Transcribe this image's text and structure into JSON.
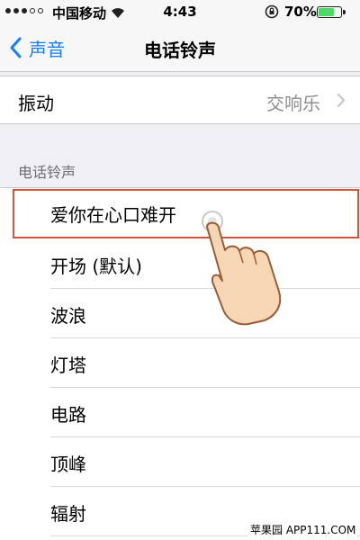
{
  "status_bar": {
    "carrier": "中国移动",
    "time": "4:43",
    "battery_percent": "70%",
    "battery_level": 0.7,
    "battery_color": "#4cd964"
  },
  "nav": {
    "back_label": "声音",
    "title": "电话铃声"
  },
  "vibration": {
    "label": "振动",
    "value": "交响乐"
  },
  "ringtones": {
    "header": "电话铃声",
    "items": [
      {
        "label": "爱你在心口难开"
      },
      {
        "label": "开场 (默认)"
      },
      {
        "label": "波浪"
      },
      {
        "label": "灯塔"
      },
      {
        "label": "电路"
      },
      {
        "label": "顶峰"
      },
      {
        "label": "辐射"
      }
    ]
  },
  "watermark": "苹果园 APP111.COM",
  "colors": {
    "accent": "#157efb",
    "highlight": "#d4563a"
  }
}
